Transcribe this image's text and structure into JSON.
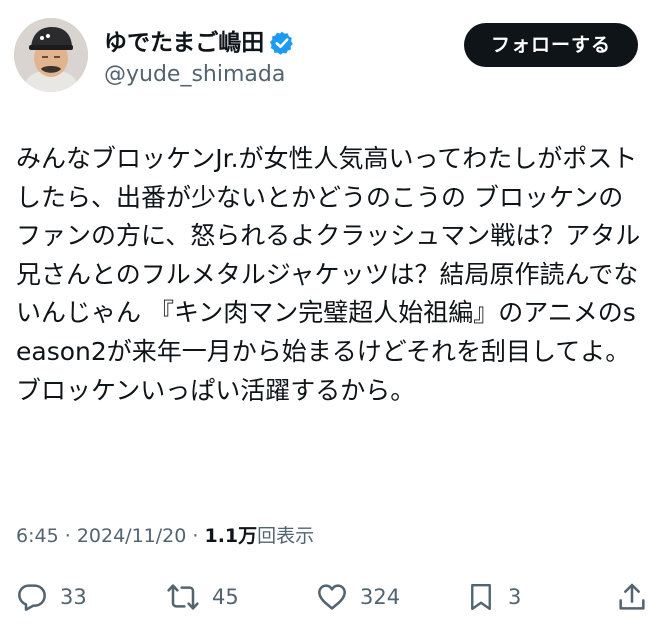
{
  "user": {
    "display_name": "ゆでたまご嶋田",
    "handle": "@yude_shimada",
    "verified": true
  },
  "follow_button": {
    "label": "フォローする"
  },
  "tweet": {
    "text": "みんなブロッケンJr.が女性人気高いってわたしがポストしたら、出番が少ないとかどうのこうの ブロッケンのファンの方に、怒られるよクラッシュマン戦は？アタル兄さんとのフルメタルジャケッツは？結局原作読んでないんじゃん 『キン肉マン完璧超人始祖編』のアニメのseason2が来年一月から始まるけどそれを刮目してよ。ブロッケンいっぱい活躍するから。"
  },
  "meta": {
    "time": "6:45",
    "separator": "·",
    "date": "2024/11/20",
    "views_count": "1.1万",
    "views_label": "回表示"
  },
  "actions": {
    "reply": {
      "icon": "reply-icon",
      "count": "33"
    },
    "retweet": {
      "icon": "retweet-icon",
      "count": "45"
    },
    "like": {
      "icon": "heart-icon",
      "count": "324"
    },
    "bookmark": {
      "icon": "bookmark-icon",
      "count": "3"
    },
    "share": {
      "icon": "share-icon"
    }
  },
  "colors": {
    "text_primary": "#0f1419",
    "text_secondary": "#536471",
    "verified_blue": "#1d9bf0",
    "button_bg": "#0f1419"
  }
}
